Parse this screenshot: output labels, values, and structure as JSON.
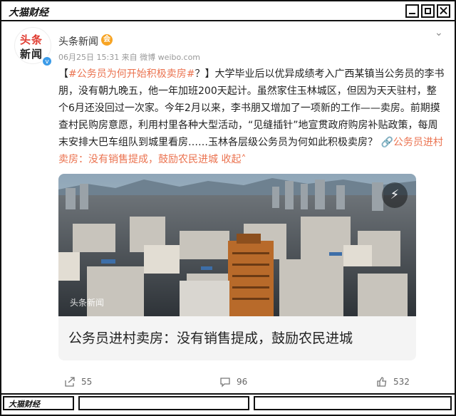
{
  "window": {
    "title": "大猫财经"
  },
  "post": {
    "avatar": {
      "line1": "头条",
      "line2": "新闻",
      "verified": "v"
    },
    "author": "头条新闻",
    "member_badge": "会",
    "meta": "06月25日 15:31  来自 微博 weibo.com",
    "hashtag": "#公务员为何开始积极卖房#",
    "body": "？】大学毕业后以优异成绩考入广西某镇当公务员的李书朋，没有朝九晚五，他一年加班200天起计。虽然家住玉林城区，但因为天天驻村，整个6月还没回过一次家。今年2月以来，李书朋又增加了一项新的工作——卖房。前期摸查村民购房意愿，利用村里各种大型活动，“见缝插针”地宣贯政府购房补贴政策，每周末安排大巴车组队到城里看房……玉林各层级公务员为何如此积极卖房？",
    "link_text": "公务员进村卖房：没有销售提成，鼓励农民进城",
    "collapse_text": "收起",
    "image_watermark": "头条新闻",
    "card_caption": "公务员进村卖房：没有销售提成，鼓励农民进城",
    "bracket_open": "【",
    "actions": {
      "share": "55",
      "comment": "96",
      "like": "532"
    }
  },
  "footer": {
    "title": "大猫财经"
  },
  "icons": [
    "chevron-down-icon",
    "play-icon",
    "share-icon",
    "comment-icon",
    "like-icon",
    "link-icon"
  ]
}
